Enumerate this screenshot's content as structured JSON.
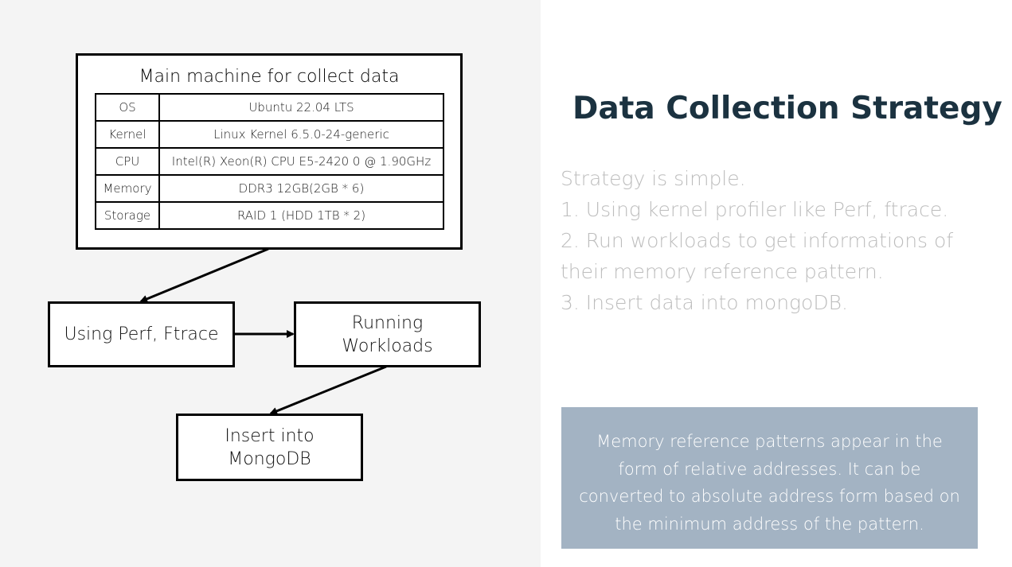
{
  "diagram": {
    "machine_title": "Main machine for collect data",
    "specs": [
      {
        "key": "OS",
        "value": "Ubuntu 22.04 LTS"
      },
      {
        "key": "Kernel",
        "value": "Linux Kernel 6.5.0-24-generic"
      },
      {
        "key": "CPU",
        "value": "Intel(R) Xeon(R) CPU E5-2420 0 @ 1.90GHz"
      },
      {
        "key": "Memory",
        "value": "DDR3 12GB(2GB * 6)"
      },
      {
        "key": "Storage",
        "value": "RAID 1 (HDD 1TB * 2)"
      }
    ],
    "profiler_box": "Using Perf, Ftrace",
    "workloads_box": "Running Workloads",
    "insert_box": "Insert into MongoDB"
  },
  "title": "Data Collection Strategy",
  "strategy_lines": [
    "Strategy is simple.",
    "1. Using kernel profiler like Perf, ftrace.",
    "2. Run workloads to get informations of",
    "their memory reference pattern.",
    "3. Insert data into mongoDB."
  ],
  "note": "Memory reference patterns appear in the form of relative addresses. It can be converted to absolute address form based on the minimum address of the pattern.",
  "colors": {
    "left_panel_bg": "#f4f4f4",
    "title": "#1b3240",
    "strategy_text": "#bdbdbd",
    "note_bg": "#a3b3c3"
  }
}
